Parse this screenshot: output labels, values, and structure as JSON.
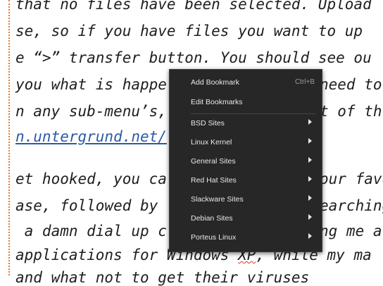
{
  "document": {
    "lines": [
      "that no files have been selected. Upload",
      "se, so if you have files you want to up",
      "e “>” transfer button. You should see ou",
      "you what is happe",
      "need to",
      "n any sub-menu’s,",
      "t of th",
      "n.untergrund.net/",
      "et hooked, you ca",
      "our favo",
      "ase, followed by",
      "earching",
      " a damn dial up c",
      "ng me a",
      "applications for Windows ",
      "XP",
      ", while my ma",
      "and what not to get their viruses"
    ]
  },
  "colors": {
    "text": "#1e1e1e",
    "link": "#2b5aa8",
    "menu_bg": "#272727",
    "margin_line": "#e07a2e"
  },
  "context_menu": {
    "items": [
      {
        "label": "Add Bookmark",
        "shortcut": "Ctrl+B",
        "submenu": false
      },
      {
        "label": "Edit Bookmarks",
        "shortcut": "",
        "submenu": false
      },
      {
        "label": "BSD Sites",
        "shortcut": "",
        "submenu": true
      },
      {
        "label": "Linux Kernel",
        "shortcut": "",
        "submenu": true
      },
      {
        "label": "General Sites",
        "shortcut": "",
        "submenu": true
      },
      {
        "label": "Red Hat Sites",
        "shortcut": "",
        "submenu": true
      },
      {
        "label": "Slackware Sites",
        "shortcut": "",
        "submenu": true
      },
      {
        "label": "Debian Sites",
        "shortcut": "",
        "submenu": true
      },
      {
        "label": "Porteus Linux",
        "shortcut": "",
        "submenu": true
      }
    ]
  }
}
